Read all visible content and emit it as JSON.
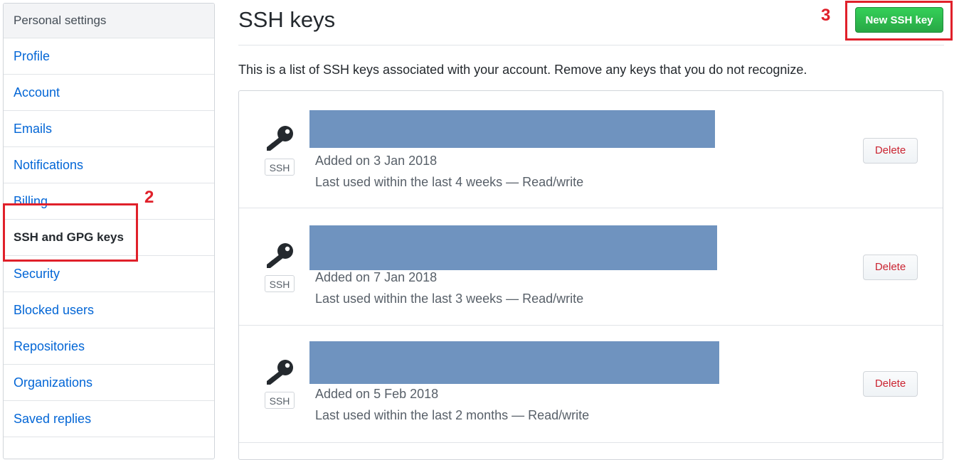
{
  "sidebar": {
    "header": "Personal settings",
    "items": [
      {
        "label": "Profile"
      },
      {
        "label": "Account"
      },
      {
        "label": "Emails"
      },
      {
        "label": "Notifications"
      },
      {
        "label": "Billing"
      },
      {
        "label": "SSH and GPG keys",
        "selected": true
      },
      {
        "label": "Security"
      },
      {
        "label": "Blocked users"
      },
      {
        "label": "Repositories"
      },
      {
        "label": "Organizations"
      },
      {
        "label": "Saved replies"
      }
    ]
  },
  "annotations": {
    "step2": "2",
    "step3": "3",
    "color": "#e0202a"
  },
  "main": {
    "title": "SSH keys",
    "new_key_label": "New SSH key",
    "description": "This is a list of SSH keys associated with your account. Remove any keys that you do not recognize.",
    "keys": [
      {
        "badge": "SSH",
        "added": "Added on 3 Jan 2018",
        "used": "Last used within the last 4 weeks — Read/write",
        "delete_label": "Delete",
        "icon": "key-icon"
      },
      {
        "badge": "SSH",
        "added": "Added on 7 Jan 2018",
        "used": "Last used within the last 3 weeks — Read/write",
        "delete_label": "Delete",
        "icon": "key-icon"
      },
      {
        "badge": "SSH",
        "added": "Added on 5 Feb 2018",
        "used": "Last used within the last 2 months — Read/write",
        "delete_label": "Delete",
        "icon": "key-icon"
      }
    ]
  },
  "colors": {
    "link": "#0366d6",
    "primary_button": "#28a745",
    "danger": "#cb2431",
    "redaction": "#6f93bf"
  }
}
